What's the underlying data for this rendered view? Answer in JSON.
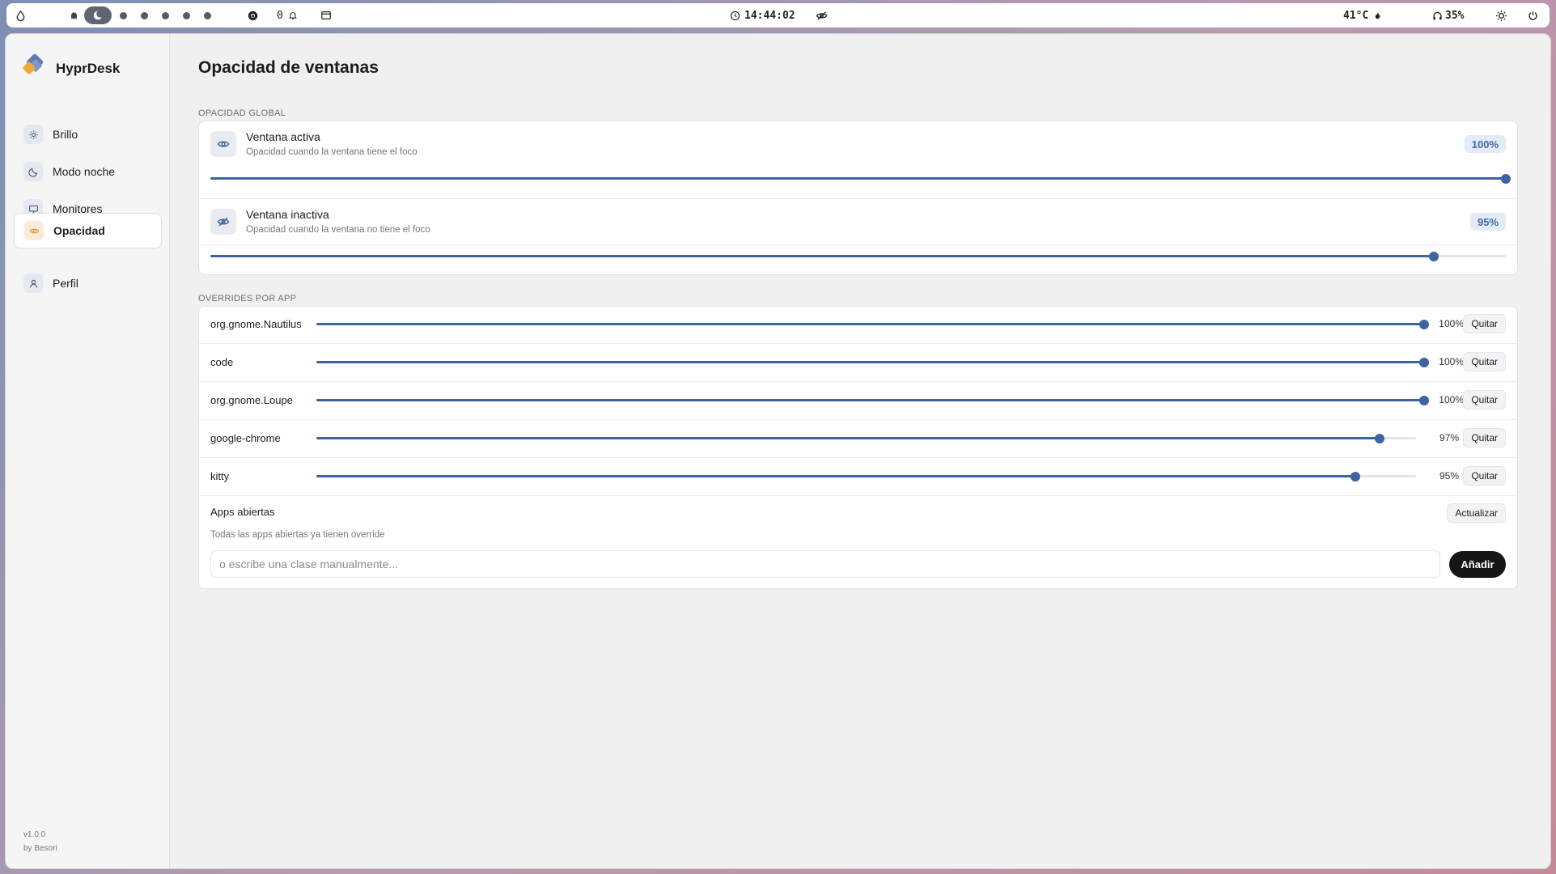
{
  "topbar": {
    "clock": "14:44:02",
    "notifications_count": "0",
    "temperature": "41°C",
    "headphones_battery": "35%"
  },
  "app": {
    "name": "HyprDesk",
    "version": "v1.0.0",
    "author": "by Besori"
  },
  "sidebar": {
    "items": [
      {
        "label": "Brillo",
        "icon": "sun-icon"
      },
      {
        "label": "Modo noche",
        "icon": "moon-icon"
      },
      {
        "label": "Monitores",
        "icon": "monitor-icon"
      },
      {
        "label": "Opacidad",
        "icon": "eye-icon",
        "active": true
      },
      {
        "label": "Perfil",
        "icon": "user-icon"
      }
    ]
  },
  "page": {
    "title": "Opacidad de ventanas",
    "global_section": "OPACIDAD GLOBAL",
    "active": {
      "title": "Ventana activa",
      "subtitle": "Opacidad cuando la ventana tiene el foco",
      "value_label": "100%",
      "value": 100
    },
    "inactive": {
      "title": "Ventana inactiva",
      "subtitle": "Opacidad cuando la ventana no tiene el foco",
      "value_label": "95%",
      "value": 95
    },
    "overrides_section": "OVERRIDES POR APP",
    "overrides": [
      {
        "app": "org.gnome.Nautilus",
        "value_label": "100%",
        "value": 100,
        "remove_label": "Quitar"
      },
      {
        "app": "code",
        "value_label": "100%",
        "value": 100,
        "remove_label": "Quitar"
      },
      {
        "app": "org.gnome.Loupe",
        "value_label": "100%",
        "value": 100,
        "remove_label": "Quitar"
      },
      {
        "app": "google-chrome",
        "value_label": "97%",
        "value": 97,
        "remove_label": "Quitar"
      },
      {
        "app": "kitty",
        "value_label": "95%",
        "value": 95,
        "remove_label": "Quitar"
      }
    ],
    "open_apps": {
      "title": "Apps abiertas",
      "refresh_label": "Actualizar",
      "subtitle": "Todas las apps abiertas ya tienen override",
      "input_placeholder": "o escribe una clase manualmente...",
      "input_value": "",
      "add_label": "Añadir"
    }
  },
  "colors": {
    "accent": "#3d64a0",
    "background": "#f0f0f0",
    "card": "#ffffff",
    "add_button": "#161616"
  }
}
